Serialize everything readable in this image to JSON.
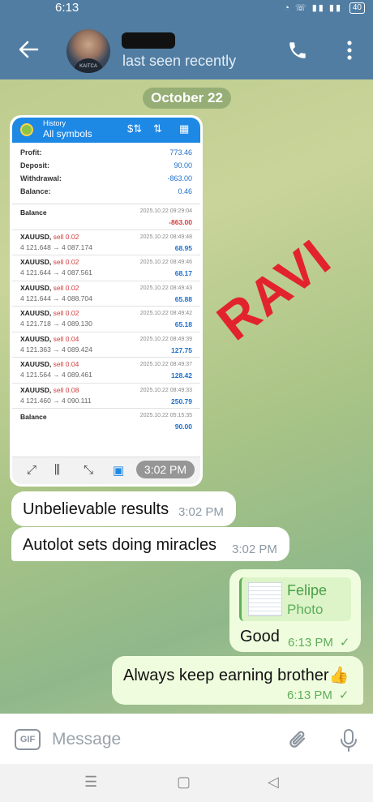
{
  "status": {
    "time": "6:13",
    "battery": "40"
  },
  "header": {
    "last_seen": "last seen recently"
  },
  "date_separator": "October 22",
  "screenshot": {
    "head_small": "History",
    "head_title": "All symbols",
    "summary": [
      {
        "k": "Profit:",
        "v": "773.46"
      },
      {
        "k": "Deposit:",
        "v": "90.00"
      },
      {
        "k": "Withdrawal:",
        "v": "-863.00"
      },
      {
        "k": "Balance:",
        "v": "0.46"
      }
    ],
    "rows": [
      {
        "sym": "Balance",
        "dir": "",
        "px": "",
        "dt": "2025.10.22 09:29:04",
        "pf": "-863.00",
        "neg": true
      },
      {
        "sym": "XAUUSD,",
        "dir": "sell 0.02",
        "px": "4 121.648 → 4 087.174",
        "dt": "2025.10.22 08:49:48",
        "pf": "68.95"
      },
      {
        "sym": "XAUUSD,",
        "dir": "sell 0.02",
        "px": "4 121.644 → 4 087.561",
        "dt": "2025.10.22 08:49:46",
        "pf": "68.17"
      },
      {
        "sym": "XAUUSD,",
        "dir": "sell 0.02",
        "px": "4 121.644 → 4 088.704",
        "dt": "2025.10.22 08:49:43",
        "pf": "65.88"
      },
      {
        "sym": "XAUUSD,",
        "dir": "sell 0.02",
        "px": "4 121.718 → 4 089.130",
        "dt": "2025.10.22 08:49:42",
        "pf": "65.18"
      },
      {
        "sym": "XAUUSD,",
        "dir": "sell 0.04",
        "px": "4 121.363 → 4 089.424",
        "dt": "2025.10.22 08:49:39",
        "pf": "127.75"
      },
      {
        "sym": "XAUUSD,",
        "dir": "sell 0.04",
        "px": "4 121.564 → 4 089.461",
        "dt": "2025.10.22 08:49:37",
        "pf": "128.42"
      },
      {
        "sym": "XAUUSD,",
        "dir": "sell 0.08",
        "px": "4 121.460 → 4 090.111",
        "dt": "2025.10.22 08:49:33",
        "pf": "250.79"
      },
      {
        "sym": "Balance",
        "dir": "",
        "px": "",
        "dt": "2025.10.22 05:15:35",
        "pf": "90.00"
      }
    ],
    "time_badge": "3:02 PM",
    "watermark": "RAVI"
  },
  "messages": [
    {
      "text": "Unbelievable results",
      "time": "3:02 PM"
    },
    {
      "text": "Autolot sets doing miracles",
      "time": "3:02 PM"
    },
    {
      "reply_name": "Felipe",
      "reply_type": "Photo",
      "text": "Good",
      "time": "6:13 PM"
    },
    {
      "text": "Always keep earning brother👍",
      "time": "6:13 PM"
    }
  ],
  "input": {
    "gif_label": "GIF",
    "placeholder": "Message"
  },
  "colors": {
    "header": "#517da2",
    "outgoing": "#effdde",
    "accent_green": "#5dae5a",
    "watermark": "#e2232e"
  },
  "icons": [
    "back-arrow-icon",
    "phone-icon",
    "more-icon",
    "paperclip-icon",
    "mic-icon"
  ]
}
